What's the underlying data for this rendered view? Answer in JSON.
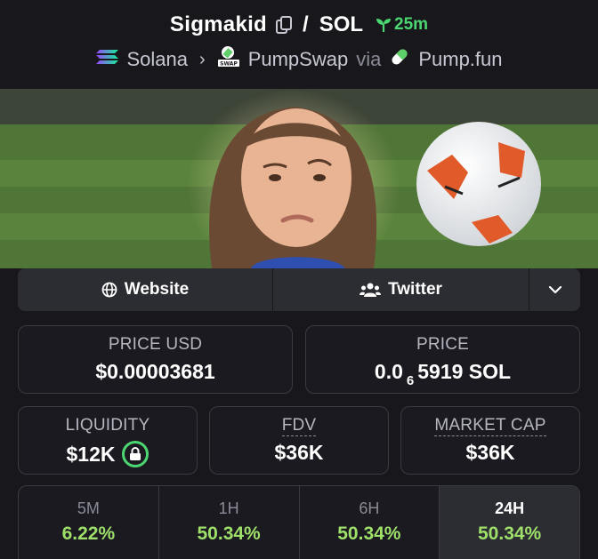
{
  "header": {
    "token_name": "Sigmakid",
    "separator": "/",
    "quote": "SOL",
    "age": "25m",
    "chain": "Solana",
    "dex": "PumpSwap",
    "via": "via",
    "launchpad": "Pump.fun"
  },
  "links": {
    "website": "Website",
    "twitter": "Twitter"
  },
  "stats": {
    "price_usd_label": "PRICE USD",
    "price_usd": "$0.00003681",
    "price_label": "PRICE",
    "price_prefix": "0.0",
    "price_zeros": "6",
    "price_digits": "5919 SOL",
    "liquidity_label": "LIQUIDITY",
    "liquidity": "$12K",
    "fdv_label": "FDV",
    "fdv": "$36K",
    "mcap_label": "MARKET CAP",
    "mcap": "$36K"
  },
  "timeframes": [
    {
      "label": "5M",
      "value": "6.22%"
    },
    {
      "label": "1H",
      "value": "50.34%"
    },
    {
      "label": "6H",
      "value": "50.34%"
    },
    {
      "label": "24H",
      "value": "50.34%"
    }
  ],
  "colors": {
    "accent_green": "#4cd671",
    "positive": "#9fe06a",
    "background": "#17171c"
  }
}
